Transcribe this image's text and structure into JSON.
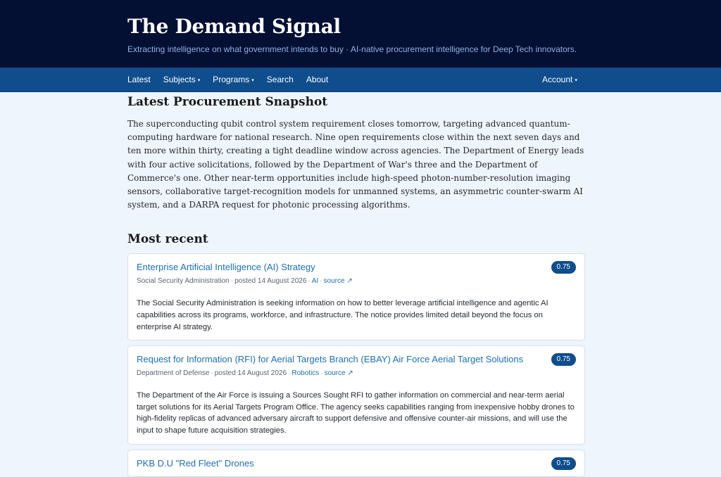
{
  "site": {
    "title": "The Demand Signal",
    "tagline": "Extracting intelligence on what government intends to buy · AI-native procurement intelligence for Deep Tech innovators."
  },
  "nav": {
    "latest": "Latest",
    "subjects": "Subjects",
    "programs": "Programs",
    "search": "Search",
    "about": "About",
    "account": "Account",
    "caret": "▾"
  },
  "snapshot": {
    "title": "Latest Procurement Snapshot",
    "body": "The superconducting qubit control system requirement closes tomorrow, targeting advanced quantum-computing hardware for national research. Nine open requirements close within the next seven days and ten more within thirty, creating a tight deadline window across agencies. The Department of Energy leads with four active solicitations, followed by the Department of War's three and the Department of Commerce's one. Other near-term opportunities include high-speed photon-number-resolution imaging sensors, collaborative target-recognition models for unmanned systems, an asymmetric counter-swarm AI system, and a DARPA request for photonic processing algorithms."
  },
  "recent": {
    "title": "Most recent",
    "items": [
      {
        "title": "Enterprise Artificial Intelligence (AI) Strategy",
        "agency": "Social Security Administration",
        "posted": "posted 14 August 2026",
        "tag": "AI",
        "source": "source ↗",
        "score": "0.75",
        "summary": "The Social Security Administration is seeking information on how to better leverage artificial intelligence and agentic AI capabilities across its programs, workforce, and infrastructure. The notice provides limited detail beyond the focus on enterprise AI strategy."
      },
      {
        "title": "Request for Information (RFI) for Aerial Targets Branch (EBAY) Air Force Aerial Target Solutions",
        "agency": "Department of Defense",
        "posted": "posted 14 August 2026",
        "tag": "Robotics",
        "source": "source ↗",
        "score": "0.75",
        "summary": "The Department of the Air Force is issuing a Sources Sought RFI to gather information on commercial and near-term aerial target solutions for its Aerial Targets Program Office. The agency seeks capabilities ranging from inexpensive hobby drones to high-fidelity replicas of advanced adversary aircraft to support defensive and offensive counter-air missions, and will use the input to shape future acquisition strategies."
      },
      {
        "title": "PKB D.U \"Red Fleet\" Drones",
        "agency": "",
        "posted": "",
        "tag": "",
        "source": "",
        "score": "0.75",
        "summary": ""
      }
    ]
  }
}
